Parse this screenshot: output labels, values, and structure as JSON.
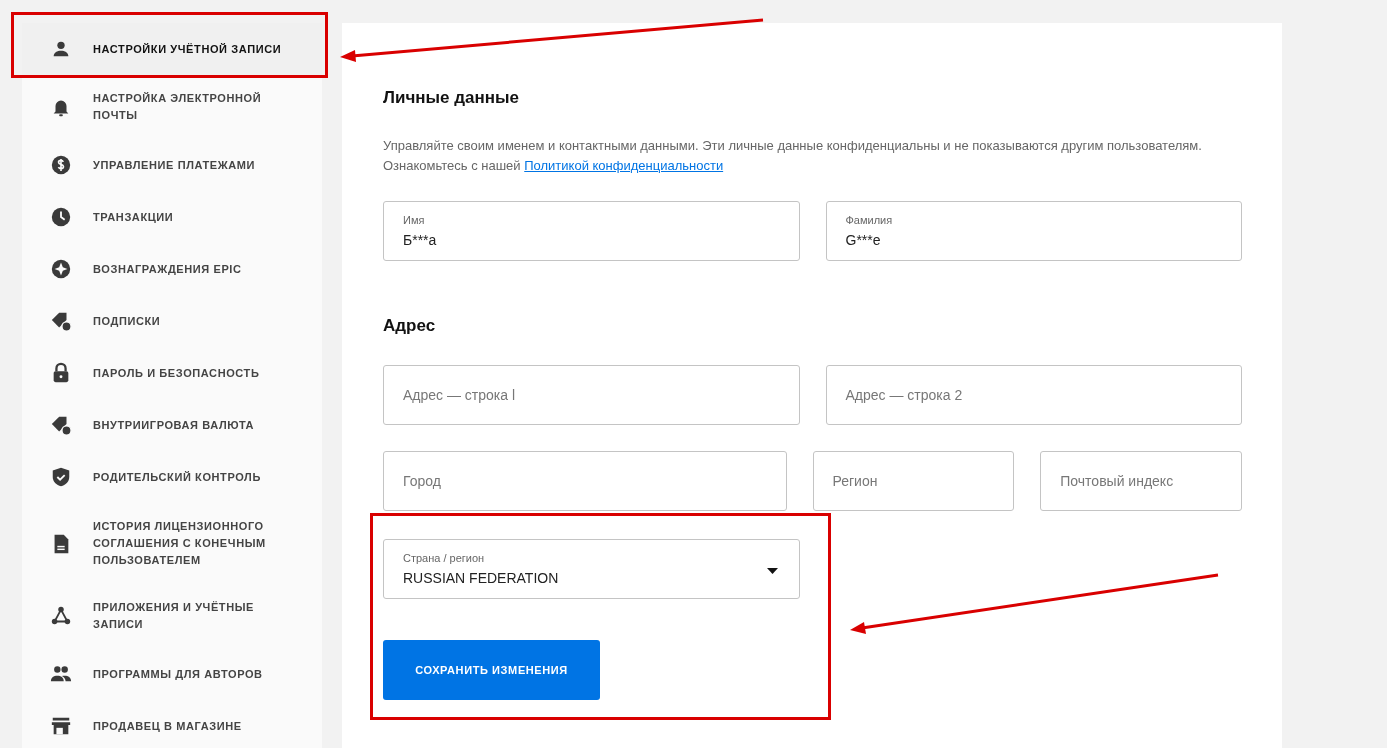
{
  "sidebar": {
    "items": [
      {
        "label": "НАСТРОЙКИ УЧЁТНОЙ ЗАПИСИ",
        "selected": true
      },
      {
        "label": "НАСТРОЙКА ЭЛЕКТРОННОЙ ПОЧТЫ",
        "selected": false
      },
      {
        "label": "УПРАВЛЕНИЕ ПЛАТЕЖАМИ",
        "selected": false
      },
      {
        "label": "ТРАНЗАКЦИИ",
        "selected": false
      },
      {
        "label": "ВОЗНАГРАЖДЕНИЯ EPIC",
        "selected": false
      },
      {
        "label": "ПОДПИСКИ",
        "selected": false
      },
      {
        "label": "ПАРОЛЬ И БЕЗОПАСНОСТЬ",
        "selected": false
      },
      {
        "label": "ВНУТРИИГРОВАЯ ВАЛЮТА",
        "selected": false
      },
      {
        "label": "РОДИТЕЛЬСКИЙ КОНТРОЛЬ",
        "selected": false
      },
      {
        "label": "ИСТОРИЯ ЛИЦЕНЗИОННОГО СОГЛАШЕНИЯ С КОНЕЧНЫМ ПОЛЬЗОВАТЕЛЕМ",
        "selected": false
      },
      {
        "label": "ПРИЛОЖЕНИЯ И УЧЁТНЫЕ ЗАПИСИ",
        "selected": false
      },
      {
        "label": "ПРОГРАММЫ ДЛЯ АВТОРОВ",
        "selected": false
      },
      {
        "label": "ПРОДАВЕЦ В МАГАЗИНЕ",
        "selected": false
      }
    ]
  },
  "personal": {
    "title": "Личные данные",
    "description": "Управляйте своим именем и контактными данными. Эти личные данные конфиденциальны и не показываются другим пользователям. Ознакомьтесь с нашей",
    "link": "Политикой конфиденциальности",
    "fields": [
      {
        "label": "Имя",
        "value": "Б***а"
      },
      {
        "label": "Фамилия",
        "value": "G***e"
      }
    ]
  },
  "address": {
    "title": "Адрес",
    "rows": [
      [
        {
          "placeholder": "Адрес — строка l"
        },
        {
          "placeholder": "Адрес — строка 2"
        }
      ],
      [
        {
          "placeholder": "Город"
        },
        {
          "placeholder": "Регион"
        },
        {
          "placeholder": "Почтовый индекс"
        }
      ]
    ],
    "country": {
      "label": "Страна / регион",
      "value": "RUSSIAN FEDERATION"
    }
  },
  "save_button": "СОХРАНИТЬ ИЗМЕНЕНИЯ"
}
